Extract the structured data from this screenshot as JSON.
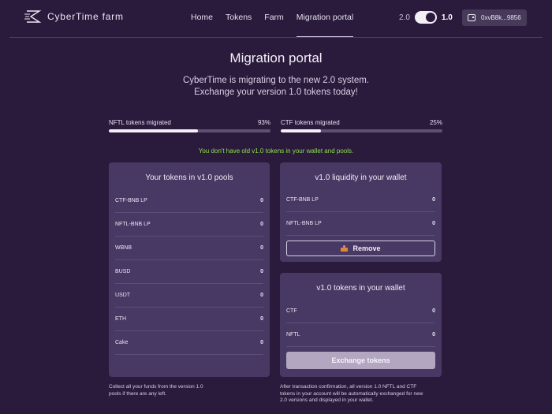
{
  "header": {
    "app_name": "CyberTime farm",
    "nav": [
      {
        "label": "Home"
      },
      {
        "label": "Tokens"
      },
      {
        "label": "Farm"
      },
      {
        "label": "Migration portal",
        "active": true
      }
    ],
    "version_old": "2.0",
    "version_new": "1.0",
    "toggle_on": true,
    "wallet_address": "0xvB8k...9856",
    "icons": {
      "logo": "cybertime-logo-icon",
      "wallet": "wallet-icon"
    }
  },
  "main": {
    "title": "Migration portal",
    "subtitle_line1": "CyberTime is migrating to the new 2.0 system.",
    "subtitle_line2": "Exchange your version 1.0 tokens today!",
    "progress": [
      {
        "label": "NFTL tokens migrated",
        "percent_label": "93%",
        "fill": 0.55
      },
      {
        "label": "CTF tokens migrated",
        "percent_label": "25%",
        "fill": 0.25
      }
    ],
    "notice": "You don't have old v1.0 tokens in your wallet and pools.",
    "notice_color": "#8ee04a"
  },
  "pools_card": {
    "title": "Your tokens in v1.0 pools",
    "rows": [
      {
        "name": "CTF-BNB LP",
        "value": "0"
      },
      {
        "name": "NFTL-BNB LP",
        "value": "0"
      },
      {
        "name": "WBNB",
        "value": "0"
      },
      {
        "name": "BUSD",
        "value": "0"
      },
      {
        "name": "USDT",
        "value": "0"
      },
      {
        "name": "ETH",
        "value": "0"
      },
      {
        "name": "Cake",
        "value": "0"
      }
    ],
    "footnote_line1": "Collect all your funds from the version 1.0",
    "footnote_line2": "pools if there are any left."
  },
  "liquidity_card": {
    "title": "v1.0 liquidity in your wallet",
    "rows": [
      {
        "name": "CTF-BNB LP",
        "value": "0"
      },
      {
        "name": "NFTL-BNB LP",
        "value": "0"
      }
    ],
    "remove_label": "Remove",
    "remove_icon": "cake-icon"
  },
  "wallet_card": {
    "title": "v1.0 tokens in your wallet",
    "rows": [
      {
        "name": "CTF",
        "value": "0"
      },
      {
        "name": "NFTL",
        "value": "0"
      }
    ],
    "exchange_label": "Exchange tokens",
    "footnote_line1": "After transaction confirmation, all version 1.0 NFTL and CTF",
    "footnote_line2": "tokens in your account will be automatically exchanged for new",
    "footnote_line3": "2.0 versions and displayed in your wallet."
  },
  "colors": {
    "background": "#2a1a3c",
    "card": "#473963",
    "accent_green": "#8ee04a"
  }
}
